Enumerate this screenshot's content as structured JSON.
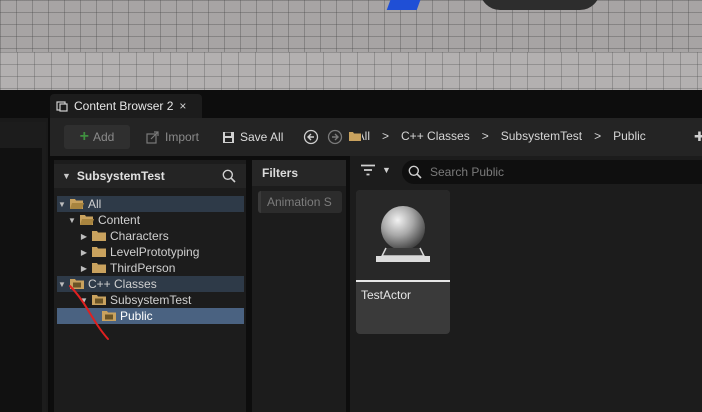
{
  "tab": {
    "title": "Content Browser 2",
    "close_glyph": "×",
    "icon": "content-browser-icon"
  },
  "toolbar": {
    "add_label": "Add",
    "import_label": "Import",
    "save_all_label": "Save All",
    "breadcrumb": [
      "All",
      "C++ Classes",
      "SubsystemTest",
      "Public"
    ],
    "separator": ">"
  },
  "sources": {
    "title": "SubsystemTest",
    "items": [
      {
        "label": "All"
      },
      {
        "label": "Content"
      },
      {
        "label": "Characters"
      },
      {
        "label": "LevelPrototyping"
      },
      {
        "label": "ThirdPerson"
      },
      {
        "label": "C++ Classes"
      },
      {
        "label": "SubsystemTest"
      },
      {
        "label": "Public"
      }
    ]
  },
  "filters": {
    "title": "Filters",
    "chip_label": "Animation S"
  },
  "search": {
    "placeholder": "Search Public"
  },
  "assets": [
    {
      "name": "TestActor"
    }
  ],
  "colors": {
    "selection": "#4a6281",
    "folder": "#c9a25e",
    "add_plus": "#3f8f3f",
    "annotation": "#e02020"
  }
}
